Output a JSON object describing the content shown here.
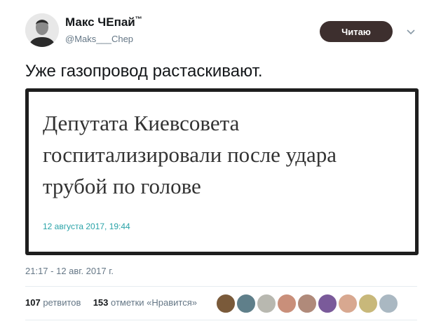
{
  "tweet": {
    "author_name": "Макс ЧЕпай",
    "author_mark": "™",
    "handle": "@Maks___Chep",
    "follow_label": "Читаю",
    "text": "Уже газопровод растаскивают.",
    "media": {
      "headline_lines": [
        "Депутата Киевсовета",
        "госпитализировали после удара",
        "трубой по голове"
      ],
      "date": "12 августа 2017, 19:44"
    },
    "timestamp": "21:17 - 12 авг. 2017 г.",
    "retweets_count": "107",
    "retweets_label": "ретвитов",
    "likes_count": "153",
    "likes_label": "отметки «Нравится»",
    "liker_colors": [
      "#7a5a3a",
      "#5f7f8a",
      "#b8b8b0",
      "#c98f7a",
      "#b08a7a",
      "#7a5a9a",
      "#d8a890",
      "#c8b87a",
      "#aab8c2"
    ]
  },
  "colors": {
    "follow_button_bg": "#3d2f2e",
    "media_date": "#2aa3a8",
    "muted_text": "#657786"
  },
  "icons": [
    "avatar-portrait",
    "chevron-down-icon",
    "default-avatar-icon"
  ]
}
